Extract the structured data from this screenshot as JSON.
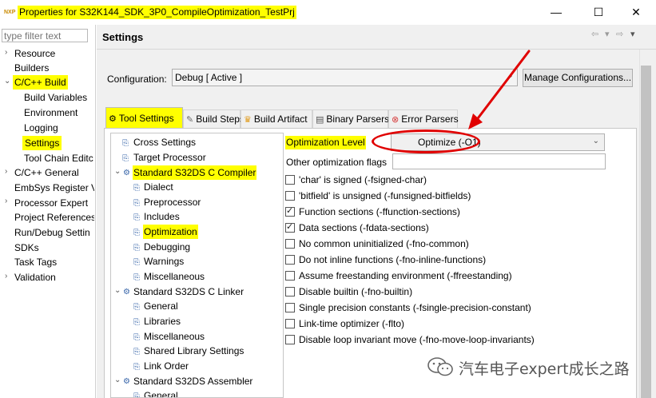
{
  "window": {
    "app_icon": "NXP",
    "title": "Properties for S32K144_SDK_3P0_CompileOptimization_TestPrj",
    "minimize": "—",
    "maximize": "☐",
    "close": "✕"
  },
  "filter": {
    "placeholder": "type filter text"
  },
  "left_tree": [
    {
      "label": "Resource"
    },
    {
      "label": "Builders"
    },
    {
      "label": "C/C++ Build"
    },
    {
      "label": "Build Variables"
    },
    {
      "label": "Environment"
    },
    {
      "label": "Logging"
    },
    {
      "label": "Settings"
    },
    {
      "label": "Tool Chain Editc"
    },
    {
      "label": "C/C++ General"
    },
    {
      "label": "EmbSys Register V"
    },
    {
      "label": "Processor Expert"
    },
    {
      "label": "Project References"
    },
    {
      "label": "Run/Debug Settin"
    },
    {
      "label": "SDKs"
    },
    {
      "label": "Task Tags"
    },
    {
      "label": "Validation"
    }
  ],
  "header": {
    "title": "Settings"
  },
  "configuration": {
    "label": "Configuration:",
    "value": "Debug  [ Active ]",
    "manage_button": "Manage Configurations..."
  },
  "tabs": [
    {
      "label": "Tool Settings"
    },
    {
      "label": "Build Steps"
    },
    {
      "label": "Build Artifact"
    },
    {
      "label": "Binary Parsers"
    },
    {
      "label": "Error Parsers"
    }
  ],
  "inner_tree": [
    {
      "label": "Cross Settings"
    },
    {
      "label": "Target Processor"
    },
    {
      "label": "Standard S32DS C Compiler"
    },
    {
      "label": "Dialect"
    },
    {
      "label": "Preprocessor"
    },
    {
      "label": "Includes"
    },
    {
      "label": "Optimization"
    },
    {
      "label": "Debugging"
    },
    {
      "label": "Warnings"
    },
    {
      "label": "Miscellaneous"
    },
    {
      "label": "Standard S32DS C Linker"
    },
    {
      "label": "General"
    },
    {
      "label": "Libraries"
    },
    {
      "label": "Miscellaneous"
    },
    {
      "label": "Shared Library Settings"
    },
    {
      "label": "Link Order"
    },
    {
      "label": "Standard S32DS Assembler"
    },
    {
      "label": "General"
    }
  ],
  "optimization": {
    "level_label": "Optimization Level",
    "level_value": "Optimize (-O1)",
    "other_flags_label": "Other optimization flags",
    "other_flags_value": "",
    "options": [
      {
        "label": "'char' is signed (-fsigned-char)",
        "checked": false
      },
      {
        "label": "'bitfield' is unsigned (-funsigned-bitfields)",
        "checked": false
      },
      {
        "label": "Function sections (-ffunction-sections)",
        "checked": true
      },
      {
        "label": "Data sections (-fdata-sections)",
        "checked": true
      },
      {
        "label": "No common uninitialized (-fno-common)",
        "checked": false
      },
      {
        "label": "Do not inline functions (-fno-inline-functions)",
        "checked": false
      },
      {
        "label": "Assume freestanding environment (-ffreestanding)",
        "checked": false
      },
      {
        "label": "Disable builtin (-fno-builtin)",
        "checked": false
      },
      {
        "label": "Single precision constants (-fsingle-precision-constant)",
        "checked": false
      },
      {
        "label": "Link-time optimizer (-flto)",
        "checked": false
      },
      {
        "label": "Disable loop invariant move (-fno-move-loop-invariants)",
        "checked": false
      }
    ]
  },
  "watermark": {
    "text": "汽车电子expert成长之路"
  },
  "colors": {
    "highlight": "#ffff00",
    "annotation": "#e00000"
  }
}
